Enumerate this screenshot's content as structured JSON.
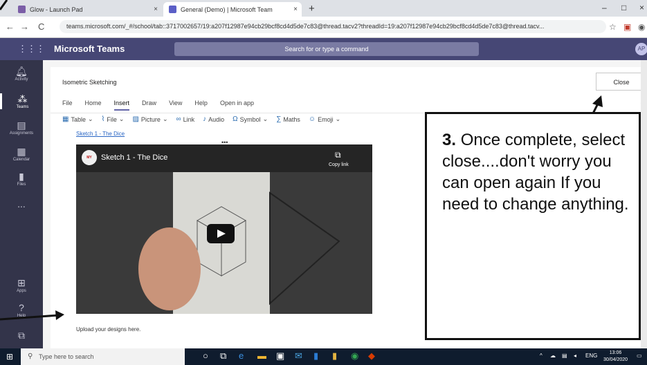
{
  "browser": {
    "tabs": [
      {
        "label": "Glow - Launch Pad",
        "close": "×"
      },
      {
        "label": "General (Demo) | Microsoft Team",
        "close": "×"
      }
    ],
    "new_tab": "+",
    "url": "teams.microsoft.com/_#/school/tab::3717002657/19:a207f12987e94cb29bcf8cd4d5de7c83@thread.tacv2?threadId=19:a207f12987e94cb29bcf8cd4d5de7c83@thread.tacv..."
  },
  "teams": {
    "title": "Microsoft Teams",
    "search_placeholder": "Search for or type a command",
    "avatar": "AP",
    "rail": [
      {
        "label": "Activity"
      },
      {
        "label": "Teams"
      },
      {
        "label": "Assignments"
      },
      {
        "label": "Calendar"
      },
      {
        "label": "Files"
      },
      {
        "label": "..."
      },
      {
        "label": "Apps"
      },
      {
        "label": "Help"
      }
    ]
  },
  "document": {
    "title": "Isometric Sketching",
    "close_label": "Close",
    "menus": [
      "File",
      "Home",
      "Insert",
      "Draw",
      "View",
      "Help",
      "Open in app"
    ],
    "active_menu": "Insert",
    "ribbon": [
      "Table",
      "File",
      "Picture",
      "Link",
      "Audio",
      "Symbol",
      "Maths",
      "Emoji"
    ],
    "link_text": "Sketch 1 - The Dice",
    "video_title": "Sketch 1 - The Dice",
    "copy_link": "Copy link",
    "upload_text": "Upload your designs here."
  },
  "callout": {
    "step": "3.",
    "text": "Once complete, select close....don't worry you can open again If you need to change anything."
  },
  "taskbar": {
    "search_placeholder": "Type here to search",
    "language": "ENG",
    "time": "13:06",
    "date": "30/04/2020"
  }
}
